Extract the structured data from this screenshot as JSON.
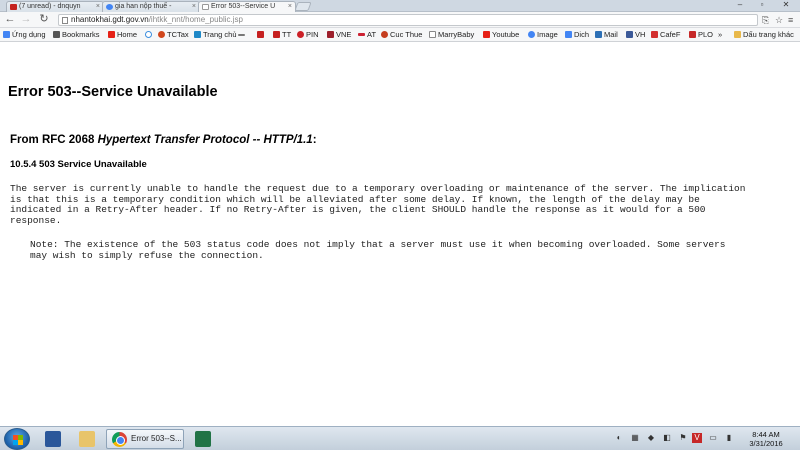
{
  "tabs": [
    {
      "title": "(7 unread) - dnquyn",
      "favicon_color": "#c5221f"
    },
    {
      "title": "gia han nộp thuế -",
      "favicon_color": "#4285f4"
    },
    {
      "title": "Error 503--Service U",
      "favicon_color": "#cccccc"
    }
  ],
  "address_bar": {
    "host": "nhantokhai.gdt.gov.vn",
    "path": "/ihtkk_nnt/home_public.jsp"
  },
  "bookmarks": [
    {
      "label": "Ứng dụng",
      "icon": "apps-grid-icon",
      "color": "#4285f4"
    },
    {
      "label": "Bookmarks",
      "icon": "star-icon",
      "color": "#555555"
    },
    {
      "label": "Home",
      "icon": "youtube-icon",
      "color": "#e62117"
    },
    {
      "label": "",
      "icon": "globe-icon",
      "color": "#3b8ede"
    },
    {
      "label": "TCTax",
      "icon": "circle-icon",
      "color": "#d0461c"
    },
    {
      "label": "Trang chủ",
      "icon": "page-icon",
      "color": "#1e88c7"
    },
    {
      "label": "",
      "icon": "dash-icon",
      "color": "#777777"
    },
    {
      "label": "",
      "icon": "red-square-icon",
      "color": "#c52020"
    },
    {
      "label": "TT",
      "icon": "red-square-icon",
      "color": "#c52020"
    },
    {
      "label": "PIN",
      "icon": "pinterest-icon",
      "color": "#cb2027"
    },
    {
      "label": "VNE",
      "icon": "page-icon",
      "color": "#9c1f2b"
    },
    {
      "label": "AT",
      "icon": "dash-icon",
      "color": "#cc2233"
    },
    {
      "label": "Cuc Thue",
      "icon": "circle-icon",
      "color": "#c53e1f"
    },
    {
      "label": "MarryBaby",
      "icon": "page-icon",
      "color": "#888888"
    },
    {
      "label": "Youtube",
      "icon": "youtube-icon",
      "color": "#e62117"
    },
    {
      "label": "Image",
      "icon": "google-icon",
      "color": "#4285f4"
    },
    {
      "label": "Dich",
      "icon": "translate-icon",
      "color": "#4285f4"
    },
    {
      "label": "Mail",
      "icon": "mail-icon",
      "color": "#2c6fb5"
    },
    {
      "label": "VH",
      "icon": "facebook-icon",
      "color": "#3b5998"
    },
    {
      "label": "CafeF",
      "icon": "page-icon",
      "color": "#d32f2f"
    },
    {
      "label": "PLO",
      "icon": "page-icon",
      "color": "#c62828"
    },
    {
      "label": "»",
      "icon": "",
      "color": "#555555"
    },
    {
      "label": "Dấu trang khác",
      "icon": "folder-icon",
      "color": "#e8b84a"
    }
  ],
  "page": {
    "heading": "Error 503--Service Unavailable",
    "rfc_prefix": "From RFC 2068 ",
    "rfc_italic": "Hypertext Transfer Protocol -- HTTP/1.1",
    "rfc_suffix": ":",
    "section_title": "10.5.4 503 Service Unavailable",
    "body_lines": [
      "The server is currently unable to handle the request due to a temporary overloading or maintenance of the server. The implication",
      "is that this is a temporary condition which will be alleviated after some delay. If known, the length of the delay may be",
      "indicated in a Retry-After header. If no Retry-After is given, the client SHOULD handle the response as it would for a 500",
      "response."
    ],
    "note_lines": [
      "Note: The existence of the 503 status code does not imply that a server must use it when becoming overloaded. Some servers",
      "may wish to simply refuse the connection."
    ]
  },
  "taskbar": {
    "active_window_label": "Error 503--S...",
    "clock_time": "8:44 AM",
    "clock_date": "3/31/2016"
  }
}
